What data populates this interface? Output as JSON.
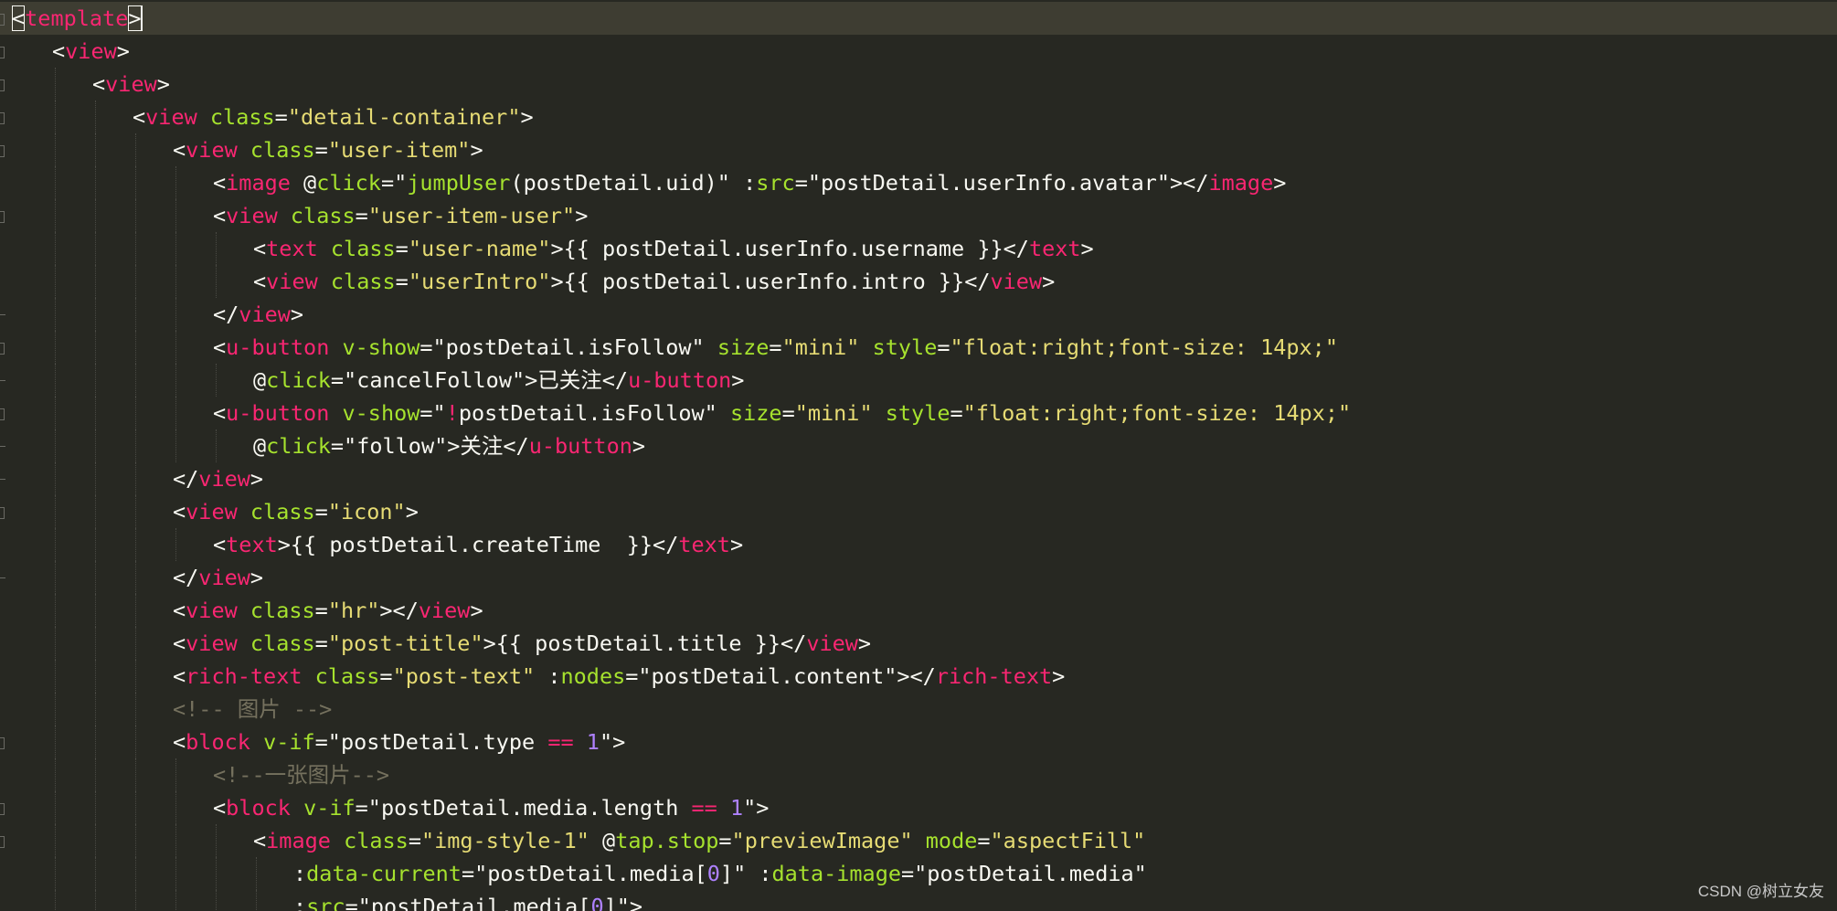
{
  "editor": {
    "language": "vue-template",
    "theme": "monokai",
    "colors": {
      "background": "#272822",
      "current_line": "#3e3d32",
      "tag": "#f92672",
      "attribute": "#a6e22e",
      "string": "#e6db74",
      "number": "#ae81ff",
      "comment": "#75715e",
      "text": "#f8f8f2"
    },
    "lines": [
      {
        "indent": 0,
        "fold": "open",
        "current": true,
        "caret_after_token": 2,
        "tokens": [
          {
            "t": "<",
            "c": "pun"
          },
          {
            "t": "template",
            "c": "tag"
          },
          {
            "t": ">",
            "c": "pun"
          }
        ]
      },
      {
        "indent": 1,
        "fold": "open",
        "tokens": [
          {
            "t": "<",
            "c": "pun"
          },
          {
            "t": "view",
            "c": "tag"
          },
          {
            "t": ">",
            "c": "pun"
          }
        ]
      },
      {
        "indent": 2,
        "fold": "open",
        "tokens": [
          {
            "t": "<",
            "c": "pun"
          },
          {
            "t": "view",
            "c": "tag"
          },
          {
            "t": ">",
            "c": "pun"
          }
        ]
      },
      {
        "indent": 3,
        "fold": "open",
        "tokens": [
          {
            "t": "<",
            "c": "pun"
          },
          {
            "t": "view",
            "c": "tag"
          },
          {
            "t": " ",
            "c": "pun"
          },
          {
            "t": "class",
            "c": "attr"
          },
          {
            "t": "=",
            "c": "pun"
          },
          {
            "t": "\"detail-container\"",
            "c": "str"
          },
          {
            "t": ">",
            "c": "pun"
          }
        ]
      },
      {
        "indent": 4,
        "fold": "open",
        "tokens": [
          {
            "t": "<",
            "c": "pun"
          },
          {
            "t": "view",
            "c": "tag"
          },
          {
            "t": " ",
            "c": "pun"
          },
          {
            "t": "class",
            "c": "attr"
          },
          {
            "t": "=",
            "c": "pun"
          },
          {
            "t": "\"user-item\"",
            "c": "str"
          },
          {
            "t": ">",
            "c": "pun"
          }
        ]
      },
      {
        "indent": 5,
        "fold": "none",
        "tokens": [
          {
            "t": "<",
            "c": "pun"
          },
          {
            "t": "image",
            "c": "tag"
          },
          {
            "t": " @",
            "c": "pun"
          },
          {
            "t": "click",
            "c": "attr"
          },
          {
            "t": "=\"",
            "c": "pun"
          },
          {
            "t": "jumpUser",
            "c": "attr"
          },
          {
            "t": "(postDetail.uid)\"",
            "c": "pun"
          },
          {
            "t": " :",
            "c": "pun"
          },
          {
            "t": "src",
            "c": "attr"
          },
          {
            "t": "=\"postDetail.userInfo.avatar\"",
            "c": "pun"
          },
          {
            "t": "></",
            "c": "pun"
          },
          {
            "t": "image",
            "c": "tag"
          },
          {
            "t": ">",
            "c": "pun"
          }
        ]
      },
      {
        "indent": 5,
        "fold": "open",
        "tokens": [
          {
            "t": "<",
            "c": "pun"
          },
          {
            "t": "view",
            "c": "tag"
          },
          {
            "t": " ",
            "c": "pun"
          },
          {
            "t": "class",
            "c": "attr"
          },
          {
            "t": "=",
            "c": "pun"
          },
          {
            "t": "\"user-item-user\"",
            "c": "str"
          },
          {
            "t": ">",
            "c": "pun"
          }
        ]
      },
      {
        "indent": 6,
        "fold": "none",
        "tokens": [
          {
            "t": "<",
            "c": "pun"
          },
          {
            "t": "text",
            "c": "tag"
          },
          {
            "t": " ",
            "c": "pun"
          },
          {
            "t": "class",
            "c": "attr"
          },
          {
            "t": "=",
            "c": "pun"
          },
          {
            "t": "\"user-name\"",
            "c": "str"
          },
          {
            "t": ">{{ postDetail.userInfo.username }}</",
            "c": "pun"
          },
          {
            "t": "text",
            "c": "tag"
          },
          {
            "t": ">",
            "c": "pun"
          }
        ]
      },
      {
        "indent": 6,
        "fold": "none",
        "tokens": [
          {
            "t": "<",
            "c": "pun"
          },
          {
            "t": "view",
            "c": "tag"
          },
          {
            "t": " ",
            "c": "pun"
          },
          {
            "t": "class",
            "c": "attr"
          },
          {
            "t": "=",
            "c": "pun"
          },
          {
            "t": "\"userIntro\"",
            "c": "str"
          },
          {
            "t": ">{{ postDetail.userInfo.intro }}</",
            "c": "pun"
          },
          {
            "t": "view",
            "c": "tag"
          },
          {
            "t": ">",
            "c": "pun"
          }
        ]
      },
      {
        "indent": 5,
        "fold": "end",
        "tokens": [
          {
            "t": "</",
            "c": "pun"
          },
          {
            "t": "view",
            "c": "tag"
          },
          {
            "t": ">",
            "c": "pun"
          }
        ]
      },
      {
        "indent": 5,
        "fold": "open",
        "tokens": [
          {
            "t": "<",
            "c": "pun"
          },
          {
            "t": "u-button",
            "c": "tag"
          },
          {
            "t": " ",
            "c": "pun"
          },
          {
            "t": "v-show",
            "c": "attr"
          },
          {
            "t": "=\"postDetail.isFollow\"",
            "c": "pun"
          },
          {
            "t": " ",
            "c": "pun"
          },
          {
            "t": "size",
            "c": "attr"
          },
          {
            "t": "=",
            "c": "pun"
          },
          {
            "t": "\"mini\"",
            "c": "str"
          },
          {
            "t": " ",
            "c": "pun"
          },
          {
            "t": "style",
            "c": "attr"
          },
          {
            "t": "=",
            "c": "pun"
          },
          {
            "t": "\"float:right;font-size: 14px;\"",
            "c": "str"
          }
        ]
      },
      {
        "indent": 6,
        "fold": "end",
        "tokens": [
          {
            "t": "@",
            "c": "pun"
          },
          {
            "t": "click",
            "c": "attr"
          },
          {
            "t": "=\"cancelFollow\">已关注</",
            "c": "pun"
          },
          {
            "t": "u-button",
            "c": "tag"
          },
          {
            "t": ">",
            "c": "pun"
          }
        ]
      },
      {
        "indent": 5,
        "fold": "open",
        "tokens": [
          {
            "t": "<",
            "c": "pun"
          },
          {
            "t": "u-button",
            "c": "tag"
          },
          {
            "t": " ",
            "c": "pun"
          },
          {
            "t": "v-show",
            "c": "attr"
          },
          {
            "t": "=\"",
            "c": "pun"
          },
          {
            "t": "!",
            "c": "op"
          },
          {
            "t": "postDetail.isFollow\"",
            "c": "pun"
          },
          {
            "t": " ",
            "c": "pun"
          },
          {
            "t": "size",
            "c": "attr"
          },
          {
            "t": "=",
            "c": "pun"
          },
          {
            "t": "\"mini\"",
            "c": "str"
          },
          {
            "t": " ",
            "c": "pun"
          },
          {
            "t": "style",
            "c": "attr"
          },
          {
            "t": "=",
            "c": "pun"
          },
          {
            "t": "\"float:right;font-size: 14px;\"",
            "c": "str"
          }
        ]
      },
      {
        "indent": 6,
        "fold": "end",
        "tokens": [
          {
            "t": "@",
            "c": "pun"
          },
          {
            "t": "click",
            "c": "attr"
          },
          {
            "t": "=\"follow\">关注</",
            "c": "pun"
          },
          {
            "t": "u-button",
            "c": "tag"
          },
          {
            "t": ">",
            "c": "pun"
          }
        ]
      },
      {
        "indent": 4,
        "fold": "end",
        "tokens": [
          {
            "t": "</",
            "c": "pun"
          },
          {
            "t": "view",
            "c": "tag"
          },
          {
            "t": ">",
            "c": "pun"
          }
        ]
      },
      {
        "indent": 4,
        "fold": "open",
        "tokens": [
          {
            "t": "<",
            "c": "pun"
          },
          {
            "t": "view",
            "c": "tag"
          },
          {
            "t": " ",
            "c": "pun"
          },
          {
            "t": "class",
            "c": "attr"
          },
          {
            "t": "=",
            "c": "pun"
          },
          {
            "t": "\"icon\"",
            "c": "str"
          },
          {
            "t": ">",
            "c": "pun"
          }
        ]
      },
      {
        "indent": 5,
        "fold": "none",
        "tokens": [
          {
            "t": "<",
            "c": "pun"
          },
          {
            "t": "text",
            "c": "tag"
          },
          {
            "t": ">{{ postDetail.createTime  }}</",
            "c": "pun"
          },
          {
            "t": "text",
            "c": "tag"
          },
          {
            "t": ">",
            "c": "pun"
          }
        ]
      },
      {
        "indent": 4,
        "fold": "end",
        "tokens": [
          {
            "t": "</",
            "c": "pun"
          },
          {
            "t": "view",
            "c": "tag"
          },
          {
            "t": ">",
            "c": "pun"
          }
        ]
      },
      {
        "indent": 4,
        "fold": "none",
        "tokens": [
          {
            "t": "<",
            "c": "pun"
          },
          {
            "t": "view",
            "c": "tag"
          },
          {
            "t": " ",
            "c": "pun"
          },
          {
            "t": "class",
            "c": "attr"
          },
          {
            "t": "=",
            "c": "pun"
          },
          {
            "t": "\"hr\"",
            "c": "str"
          },
          {
            "t": "></",
            "c": "pun"
          },
          {
            "t": "view",
            "c": "tag"
          },
          {
            "t": ">",
            "c": "pun"
          }
        ]
      },
      {
        "indent": 4,
        "fold": "none",
        "tokens": [
          {
            "t": "<",
            "c": "pun"
          },
          {
            "t": "view",
            "c": "tag"
          },
          {
            "t": " ",
            "c": "pun"
          },
          {
            "t": "class",
            "c": "attr"
          },
          {
            "t": "=",
            "c": "pun"
          },
          {
            "t": "\"post-title\"",
            "c": "str"
          },
          {
            "t": ">{{ postDetail.title }}</",
            "c": "pun"
          },
          {
            "t": "view",
            "c": "tag"
          },
          {
            "t": ">",
            "c": "pun"
          }
        ]
      },
      {
        "indent": 4,
        "fold": "none",
        "tokens": [
          {
            "t": "<",
            "c": "pun"
          },
          {
            "t": "rich-text",
            "c": "tag"
          },
          {
            "t": " ",
            "c": "pun"
          },
          {
            "t": "class",
            "c": "attr"
          },
          {
            "t": "=",
            "c": "pun"
          },
          {
            "t": "\"post-text\"",
            "c": "str"
          },
          {
            "t": " :",
            "c": "pun"
          },
          {
            "t": "nodes",
            "c": "attr"
          },
          {
            "t": "=\"postDetail.content\"",
            "c": "pun"
          },
          {
            "t": "></",
            "c": "pun"
          },
          {
            "t": "rich-text",
            "c": "tag"
          },
          {
            "t": ">",
            "c": "pun"
          }
        ]
      },
      {
        "indent": 4,
        "fold": "none",
        "tokens": [
          {
            "t": "<!-- 图片 -->",
            "c": "cmt"
          }
        ]
      },
      {
        "indent": 4,
        "fold": "open",
        "tokens": [
          {
            "t": "<",
            "c": "pun"
          },
          {
            "t": "block",
            "c": "tag"
          },
          {
            "t": " ",
            "c": "pun"
          },
          {
            "t": "v-if",
            "c": "attr"
          },
          {
            "t": "=\"postDetail.type ",
            "c": "pun"
          },
          {
            "t": "==",
            "c": "op"
          },
          {
            "t": " ",
            "c": "pun"
          },
          {
            "t": "1",
            "c": "num"
          },
          {
            "t": "\">",
            "c": "pun"
          }
        ]
      },
      {
        "indent": 5,
        "fold": "none",
        "tokens": [
          {
            "t": "<!--一张图片-->",
            "c": "cmt"
          }
        ]
      },
      {
        "indent": 5,
        "fold": "open",
        "tokens": [
          {
            "t": "<",
            "c": "pun"
          },
          {
            "t": "block",
            "c": "tag"
          },
          {
            "t": " ",
            "c": "pun"
          },
          {
            "t": "v-if",
            "c": "attr"
          },
          {
            "t": "=\"postDetail.media.length ",
            "c": "pun"
          },
          {
            "t": "==",
            "c": "op"
          },
          {
            "t": " ",
            "c": "pun"
          },
          {
            "t": "1",
            "c": "num"
          },
          {
            "t": "\">",
            "c": "pun"
          }
        ]
      },
      {
        "indent": 6,
        "fold": "open",
        "tokens": [
          {
            "t": "<",
            "c": "pun"
          },
          {
            "t": "image",
            "c": "tag"
          },
          {
            "t": " ",
            "c": "pun"
          },
          {
            "t": "class",
            "c": "attr"
          },
          {
            "t": "=",
            "c": "pun"
          },
          {
            "t": "\"img-style-1\"",
            "c": "str"
          },
          {
            "t": " @",
            "c": "pun"
          },
          {
            "t": "tap.stop",
            "c": "attr"
          },
          {
            "t": "=",
            "c": "pun"
          },
          {
            "t": "\"previewImage\"",
            "c": "str"
          },
          {
            "t": " ",
            "c": "pun"
          },
          {
            "t": "mode",
            "c": "attr"
          },
          {
            "t": "=",
            "c": "pun"
          },
          {
            "t": "\"aspectFill\"",
            "c": "str"
          }
        ]
      },
      {
        "indent": 7,
        "fold": "none",
        "tokens": [
          {
            "t": ":",
            "c": "pun"
          },
          {
            "t": "data-current",
            "c": "attr"
          },
          {
            "t": "=\"postDetail.media[",
            "c": "pun"
          },
          {
            "t": "0",
            "c": "num"
          },
          {
            "t": "]\"",
            "c": "pun"
          },
          {
            "t": " :",
            "c": "pun"
          },
          {
            "t": "data-image",
            "c": "attr"
          },
          {
            "t": "=\"postDetail.media\"",
            "c": "pun"
          }
        ]
      },
      {
        "indent": 7,
        "fold": "none",
        "tokens": [
          {
            "t": ":",
            "c": "pun"
          },
          {
            "t": "src",
            "c": "attr"
          },
          {
            "t": "=\"postDetail.media[",
            "c": "pun"
          },
          {
            "t": "0",
            "c": "num"
          },
          {
            "t": "]\">",
            "c": "pun"
          }
        ]
      }
    ]
  },
  "watermark": {
    "text": "CSDN @树立女友"
  }
}
